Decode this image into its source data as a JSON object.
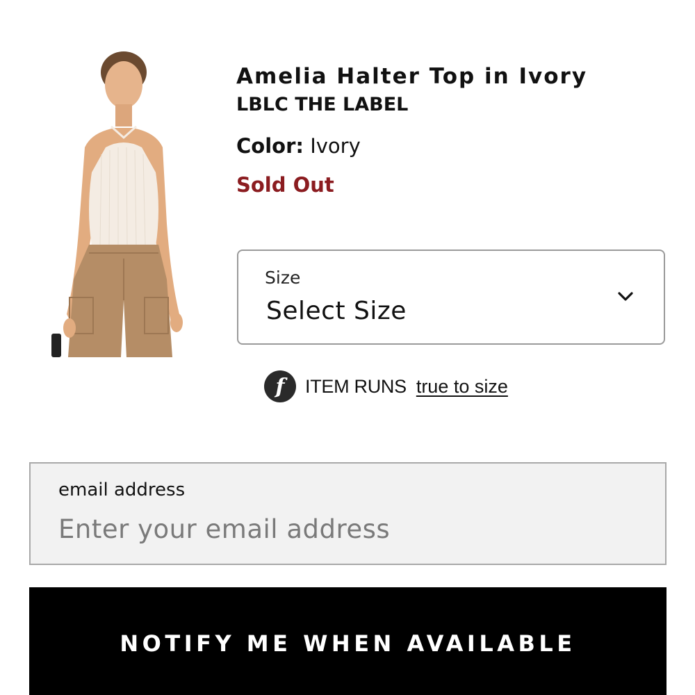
{
  "product": {
    "title": "Amelia Halter Top in Ivory",
    "brand": "LBLC THE LABEL",
    "color_label": "Color:",
    "color_value": "Ivory",
    "status": "Sold Out",
    "status_color": "#8b1c20"
  },
  "size_select": {
    "label": "Size",
    "value": "Select Size",
    "icon": "chevron-down-icon"
  },
  "fit": {
    "badge_letter": "f",
    "text": "ITEM RUNS",
    "link": "true to size"
  },
  "email": {
    "label": "email address",
    "placeholder": "Enter your email address",
    "value": ""
  },
  "notify_button": {
    "label": "NOTIFY ME WHEN AVAILABLE"
  },
  "colors": {
    "accent_sold_out": "#8b1c20",
    "button_bg": "#000000",
    "input_bg": "#f2f2f2",
    "top_ivory": "#f4ece3",
    "pants_khaki": "#b58d66"
  }
}
